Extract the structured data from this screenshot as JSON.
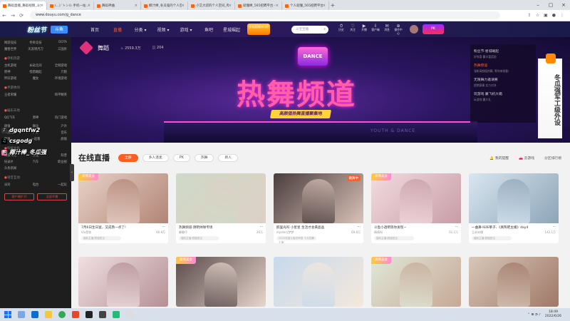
{
  "browser": {
    "tabs": [
      {
        "title": "舞蹈直播_舞蹈视频_斗鱼直播",
        "active": true
      },
      {
        "title": "(...) 'トンル 手机一站...",
        "active": false
      },
      {
        "title": "舞蹈神曲",
        "active": false
      },
      {
        "title": "椰汁棒_冬瓜强的个人空间_哔哩哔哩",
        "active": false
      },
      {
        "title": "小艾大叔的个人空间_哔哩哔哩",
        "active": false
      },
      {
        "title": "就懂棒_565招聘平台 - 58Play查",
        "active": false
      },
      {
        "title": "个人就懂_565招聘平台 - 58Play查",
        "active": false
      }
    ],
    "url": "www.douyu.com/g_dance"
  },
  "topnav": {
    "logo": "粉丝节",
    "logo2": "斗鱼",
    "links": [
      "首页",
      "直播",
      "分类 ▾",
      "视频 ▾",
      "游戏 ▾",
      "鱼吧",
      "星城崛起"
    ],
    "active_index": 1,
    "promo": "全站直播排行榜",
    "search_placeholder": "斗宝宝播",
    "tools": [
      {
        "icon": "⏱",
        "label": "历史"
      },
      {
        "icon": "♡",
        "label": "关注"
      },
      {
        "icon": "▶",
        "label": "开播"
      },
      {
        "icon": "⇩",
        "label": "客户端"
      },
      {
        "icon": "✉",
        "label": "消息"
      },
      {
        "icon": "⊕",
        "label": "操作中心"
      }
    ],
    "right_badge": "PK"
  },
  "sidebar": {
    "sections": [
      {
        "title": "",
        "rows": [
          [
            "网游竞技",
            "传奇竞技",
            "DOTA"
          ],
          [
            "魔兽世界",
            "天涯明月刀",
            "三国杀"
          ]
        ]
      },
      {
        "title": "单机热游",
        "rows": [
          [
            "主机游戏",
            "永劫无间",
            "全网游戏"
          ],
          [
            "原神",
            "怪猎崛起",
            "只狼"
          ],
          [
            "怀旧游戏",
            "魔女",
            "环境游戏"
          ]
        ]
      },
      {
        "title": "手游休闲",
        "rows": [
          [
            "王者荣耀",
            "",
            "和平精英"
          ],
          [
            "",
            "",
            ""
          ],
          [
            "",
            "",
            ""
          ],
          [
            "",
            "",
            ""
          ]
        ]
      },
      {
        "title": "娱乐天地",
        "rows": [
          [
            "QQ飞车",
            "原神",
            "热门游戏"
          ]
        ]
      },
      {
        "title": "",
        "rows": [
          [
            "颜值",
            "舞乐",
            "户外"
          ],
          [
            "二次元",
            "户外",
            "音乐"
          ],
          [
            "颜值",
            "一起看",
            "颜值"
          ]
        ]
      },
      {
        "title": "科技文化",
        "rows": [
          [
            "科技专栏",
            "文化",
            "科普"
          ],
          [
            "纪录片",
            "汽车",
            "职业视"
          ],
          [
            "头条新闻",
            "",
            ""
          ]
        ]
      },
      {
        "title": "语音互动",
        "rows": [
          [
            "派对",
            "电台",
            "一起玩"
          ]
        ]
      }
    ],
    "btn1": "客户端扩开",
    "btn2": "全部开播"
  },
  "overlay": [
    {
      "icon": "♪",
      "text": "dgqntfw2"
    },
    {
      "icon": "♫",
      "text": "csgodg"
    },
    {
      "icon": "B",
      "text": "椰汁棒_冬瓜强"
    }
  ],
  "hero": {
    "category": "舞蹈",
    "stats": [
      "♨ 2559.3万",
      "◫ 204"
    ],
    "dance_sign": "DANCE",
    "title": "热舞频道",
    "subtitle": "高颜值热舞直播聚集地",
    "floor": "YOUTH & DANCE",
    "list": [
      {
        "title": "粉丝节·星城崛起",
        "sub": "好惊喜·赢丰富奖励"
      },
      {
        "title": "热舞频道",
        "sub": "宠粉高颜值热舞, 等你来观看!",
        "active": true
      },
      {
        "title": "无限舞力邀请赛",
        "sub": "超燃赛事 实力对决"
      },
      {
        "title": "玩游戏 赢飞机大箱",
        "sub": "玩游戏·赢大礼"
      }
    ],
    "vert_ad": "冬瓜强军工级外设"
  },
  "section": {
    "title": "在线直播",
    "chips": [
      "全部",
      "多人连麦",
      "PK",
      "热舞",
      "新人"
    ],
    "active_chip": 0,
    "right": [
      "🔔 我的提醒",
      "🚗 云游戏",
      "分区排行榜"
    ]
  },
  "cards": [
    {
      "tag": "高情美女",
      "tag_style": "pk",
      "title": "7月6日生日宴，又成熟一点了!",
      "anchor": "Via是枝",
      "viewers": "46.8万",
      "cat": "福利主播·颜值担当",
      "colors": [
        "#e8d2c8",
        "#b28576"
      ]
    },
    {
      "tag": "",
      "live": "",
      "title": "热舞频道·阴明帅球专场",
      "anchor": "静静仔",
      "viewers": "26万",
      "cat": "福利主播·颜值担当",
      "colors": [
        "#cfd9c7",
        "#ddd0c6"
      ]
    },
    {
      "tag": "",
      "live": "跳舞中",
      "title": "醉里光吗 小星星 生活才会黄晶晶",
      "anchor": "mystery梦梦",
      "viewers": "69.8万",
      "cat": "2022年度斗鱼好声音 十大热舞主播",
      "colors": [
        "#4a3d3d",
        "#d9c2b8"
      ]
    },
    {
      "tag": "高情美女",
      "tag_style": "pk",
      "title": "斗鱼小透明等你发现~",
      "anchor": "倩倩呀",
      "viewers": "61.2万",
      "cat": "福利主播·颜值担当",
      "colors": [
        "#f2dcdf",
        "#c89da8"
      ]
    },
    {
      "tag": "",
      "live": "",
      "title": "一曲舞·咔咔莘子、《真陶吧主播》day4",
      "anchor": "玉米米播",
      "viewers": "142.1万",
      "cat": "福利主播·颜值担当",
      "colors": [
        "#d8e6f0",
        "#8ea5b8"
      ]
    },
    {
      "tag": "",
      "live": "",
      "title": "",
      "anchor": "",
      "viewers": "",
      "cat": "",
      "colors": [
        "#f0dfe2",
        "#b49094"
      ]
    },
    {
      "tag": "高情美女",
      "tag_style": "pk",
      "title": "",
      "anchor": "",
      "viewers": "",
      "cat": "",
      "colors": [
        "#5a4a4a",
        "#e6d6cc"
      ]
    },
    {
      "tag": "",
      "live": "",
      "title": "",
      "anchor": "",
      "viewers": "",
      "cat": "",
      "colors": [
        "#c7d9ec",
        "#f4e8dc"
      ]
    },
    {
      "tag": "高情美女",
      "tag_style": "pk",
      "title": "",
      "anchor": "",
      "viewers": "",
      "cat": "",
      "colors": [
        "#e0e8d8",
        "#c7a896"
      ]
    },
    {
      "tag": "",
      "live": "",
      "title": "",
      "anchor": "",
      "viewers": "",
      "cat": "",
      "colors": [
        "#d7c7b8",
        "#a07868"
      ]
    }
  ],
  "taskbar": {
    "time": "18:49",
    "date": "2022/6/26"
  }
}
